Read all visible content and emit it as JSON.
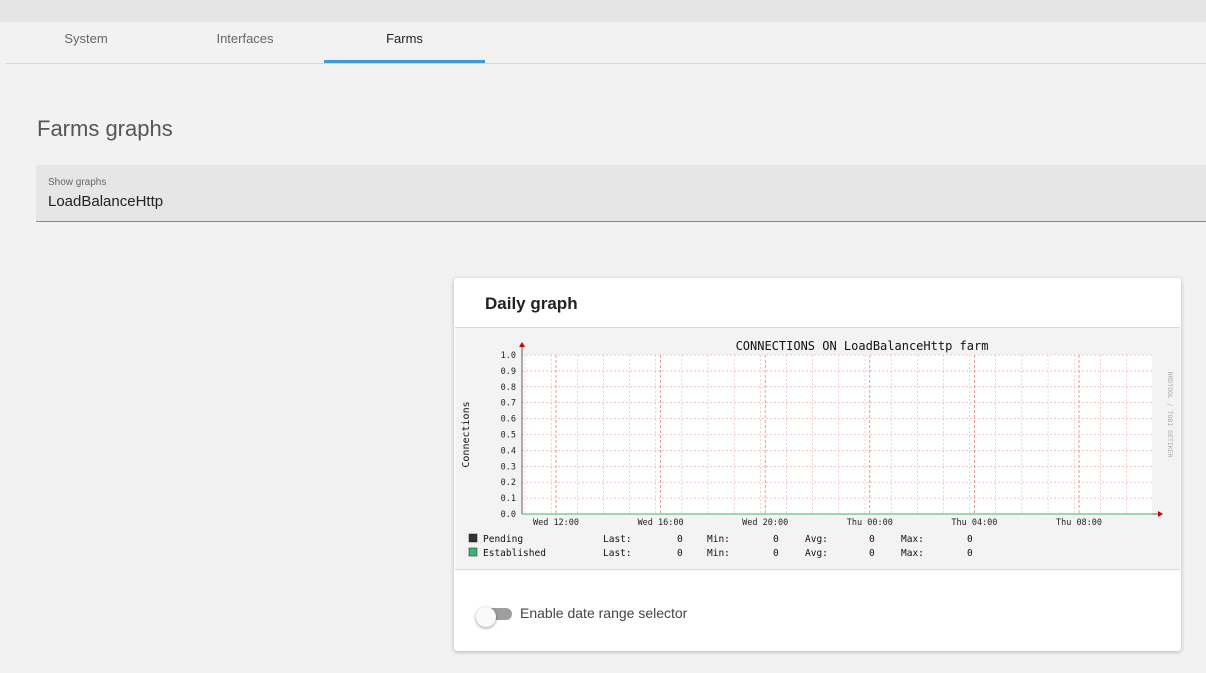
{
  "tabs": [
    {
      "label": "System"
    },
    {
      "label": "Interfaces"
    },
    {
      "label": "Farms",
      "active": true
    }
  ],
  "page": {
    "title": "Farms graphs"
  },
  "select": {
    "label": "Show graphs",
    "value": "LoadBalanceHttp"
  },
  "card": {
    "title": "Daily graph"
  },
  "toggle": {
    "label": "Enable date range selector",
    "checked": false
  },
  "colors": {
    "accent": "#3d9bd1",
    "pending": "#333333",
    "established": "#3cb371",
    "grid": "#e8a0a0",
    "axis": "#cc0000"
  },
  "chart_data": {
    "type": "line",
    "title": "CONNECTIONS ON LoadBalanceHttp farm",
    "ylabel": "Connections",
    "xlabel": "",
    "watermark": "RRDTOOL / TOBI OETIKER",
    "ylim": [
      0,
      1.0
    ],
    "y_ticks": [
      "1.0",
      "0.9",
      "0.8",
      "0.7",
      "0.6",
      "0.5",
      "0.4",
      "0.3",
      "0.2",
      "0.1",
      "0.0"
    ],
    "x_ticks": [
      "Wed 12:00",
      "Wed 16:00",
      "Wed 20:00",
      "Thu 00:00",
      "Thu 04:00",
      "Thu 08:00"
    ],
    "grid": true,
    "series": [
      {
        "name": "Pending",
        "color": "#333333",
        "values": [
          0,
          0,
          0,
          0,
          0,
          0
        ],
        "stats": {
          "last": "0",
          "min": "0",
          "avg": "0",
          "max": "0"
        }
      },
      {
        "name": "Established",
        "color": "#3cb371",
        "values": [
          0,
          0,
          0,
          0,
          0,
          0
        ],
        "stats": {
          "last": "0",
          "min": "0",
          "avg": "0",
          "max": "0"
        }
      }
    ],
    "legend_labels": {
      "last": "Last:",
      "min": "Min:",
      "avg": "Avg:",
      "max": "Max:"
    }
  }
}
